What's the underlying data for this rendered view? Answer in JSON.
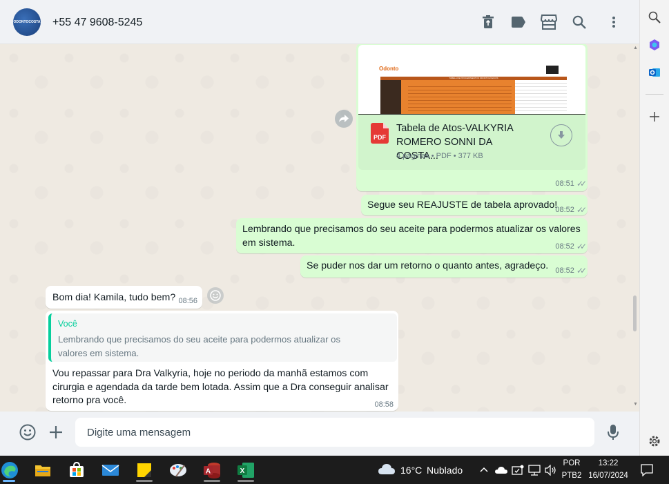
{
  "header": {
    "contact_name": "+55 47 9608-5245",
    "avatar_text": "ODONTOCOSTA"
  },
  "messages": {
    "doc": {
      "preview_title": "TABELA DE PROCEDIMENTOS ODONTOLÓGICOS",
      "preview_logo": "Odonto",
      "name_line1": "Tabela de Atos-VALKYRIA",
      "name_line2": "ROMERO SONNI DA COSTA...",
      "meta": "4 páginas • PDF • 377 KB",
      "badge": "PDF",
      "time": "08:51"
    },
    "out1": {
      "text": "Segue seu REAJUSTE de tabela aprovado!",
      "time": "08:52"
    },
    "out2": {
      "text": "Lembrando que precisamos do seu aceite para podermos atualizar os valores em sistema.",
      "time": "08:52"
    },
    "out3": {
      "text": "Se puder nos dar um retorno o quanto antes, agradeço.",
      "time": "08:52"
    },
    "in1": {
      "text": "Bom dia! Kamila, tudo bem?",
      "time": "08:56"
    },
    "in2": {
      "quote_author": "Você",
      "quote_text": "Lembrando que precisamos do seu aceite para podermos atualizar os valores em sistema.",
      "text": "Vou repassar para Dra Valkyria, hoje no periodo da manhã estamos com cirurgia e agendada da tarde bem lotada. Assim que a Dra conseguir analisar retorno pra você.",
      "time": "08:58"
    }
  },
  "composer": {
    "placeholder": "Digite uma mensagem"
  },
  "taskbar": {
    "weather_temp": "16°C",
    "weather_desc": "Nublado",
    "lang": "POR",
    "layout": "PTB2",
    "time": "13:22",
    "date": "16/07/2024"
  }
}
